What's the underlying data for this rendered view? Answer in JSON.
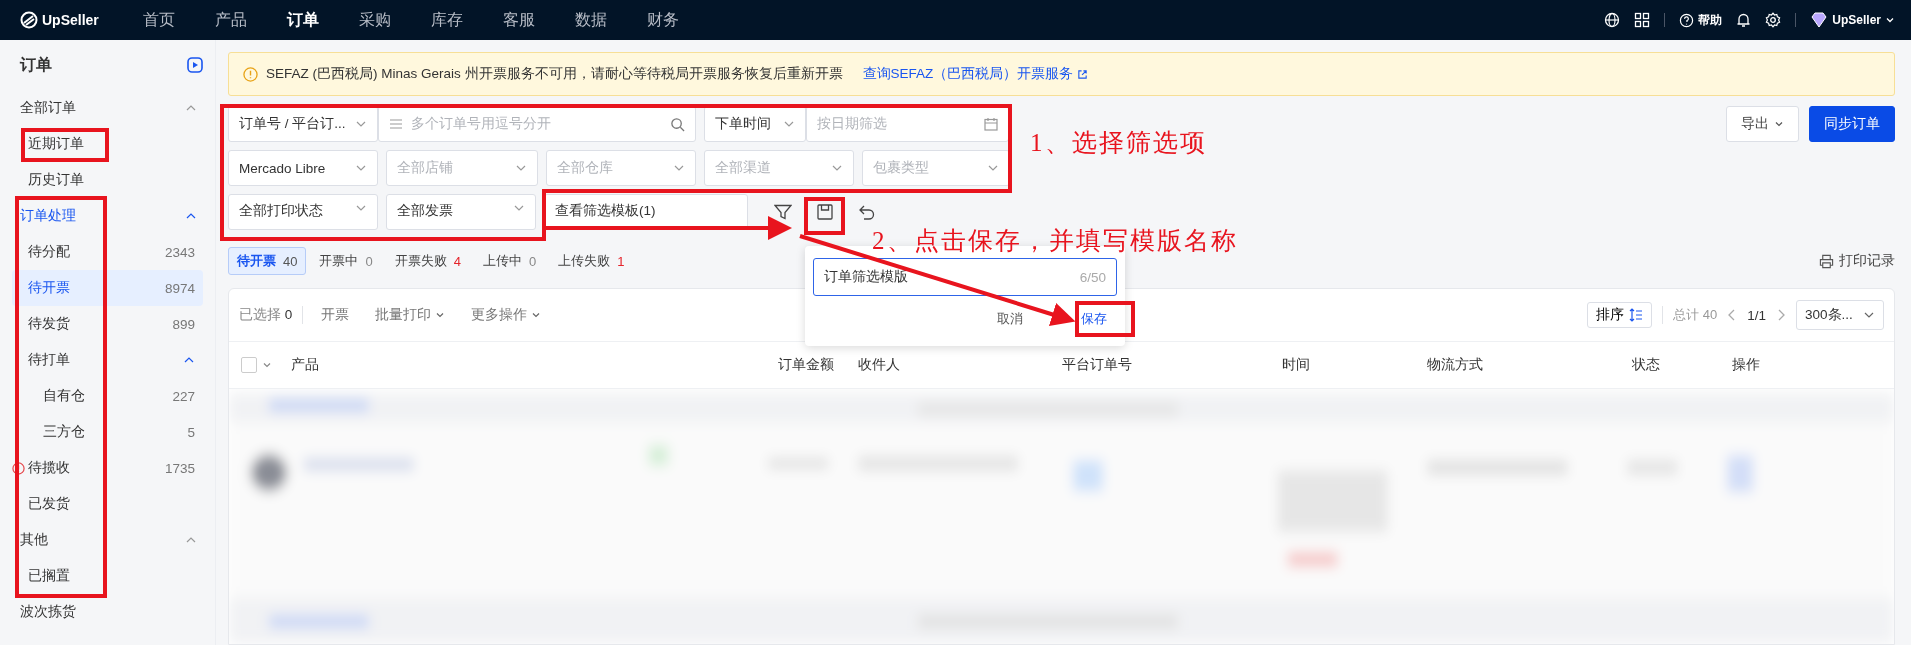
{
  "topbar": {
    "logo": "UpSeller",
    "nav": [
      {
        "label": "首页",
        "selected": false
      },
      {
        "label": "产品",
        "selected": false
      },
      {
        "label": "订单",
        "selected": true
      },
      {
        "label": "采购",
        "selected": false
      },
      {
        "label": "库存",
        "selected": false
      },
      {
        "label": "客服",
        "selected": false
      },
      {
        "label": "数据",
        "selected": false
      },
      {
        "label": "财务",
        "selected": false
      }
    ],
    "help": "帮助",
    "account": "UpSeller"
  },
  "sidebar": {
    "title": "订单",
    "groups": [
      {
        "kind": "group",
        "label": "全部订单",
        "selected": false,
        "expanded": true,
        "items": [
          {
            "label": "近期订单",
            "selected": false
          },
          {
            "label": "历史订单",
            "selected": false
          }
        ]
      },
      {
        "kind": "group",
        "label": "订单处理",
        "selected": true,
        "expanded": true,
        "items": [
          {
            "label": "待分配",
            "count": "2343",
            "selected": false,
            "alert": false
          },
          {
            "label": "待开票",
            "count": "8974",
            "selected": true,
            "alert": false
          },
          {
            "label": "待发货",
            "count": "899",
            "selected": false,
            "alert": false
          },
          {
            "label": "待打单",
            "selected": false,
            "expanded": true,
            "children": [
              {
                "label": "自有仓",
                "count": "227",
                "selected": false
              },
              {
                "label": "三方仓",
                "count": "5",
                "selected": false
              }
            ]
          },
          {
            "label": "待揽收",
            "count": "1735",
            "selected": false,
            "alert": true
          },
          {
            "label": "已发货",
            "selected": false,
            "alert": false
          }
        ]
      },
      {
        "kind": "group",
        "label": "其他",
        "selected": false,
        "expanded": true,
        "items": [
          {
            "label": "已搁置",
            "selected": false
          }
        ]
      },
      {
        "kind": "link",
        "label": "波次拣货",
        "selected": false
      }
    ]
  },
  "banner": {
    "text": "SEFAZ (巴西税局) Minas Gerais 州开票服务不可用，请耐心等待税局开票服务恢复后重新开票",
    "link": "查询SEFAZ（巴西税局）开票服务"
  },
  "filters": [
    [
      {
        "kind": "select",
        "value": "订单号 / 平台订..."
      },
      {
        "kind": "search",
        "placeholder": "多个订单号用逗号分开"
      },
      {
        "kind": "select",
        "value": "下单时间"
      },
      {
        "kind": "date",
        "placeholder": "按日期筛选"
      }
    ],
    [
      {
        "kind": "select",
        "value": "Mercado Libre"
      },
      {
        "kind": "select",
        "placeholder": "全部店铺"
      },
      {
        "kind": "select",
        "placeholder": "全部仓库"
      },
      {
        "kind": "select",
        "placeholder": "全部渠道"
      },
      {
        "kind": "select",
        "placeholder": "包裹类型"
      }
    ],
    [
      {
        "kind": "select",
        "value": "全部打印状态"
      },
      {
        "kind": "select",
        "value": "全部发票"
      },
      {
        "kind": "template",
        "value": "查看筛选模板(1)"
      }
    ]
  ],
  "actions": {
    "export": "导出",
    "sync": "同步订单"
  },
  "status_tabs": [
    {
      "label": "待开票",
      "count": "40",
      "selected": true,
      "alert": false
    },
    {
      "label": "开票中",
      "count": "0",
      "selected": false,
      "alert": false
    },
    {
      "label": "开票失败",
      "count": "4",
      "selected": false,
      "alert": true
    },
    {
      "label": "上传中",
      "count": "0",
      "selected": false,
      "alert": false
    },
    {
      "label": "上传失败",
      "count": "1",
      "selected": false,
      "alert": true
    }
  ],
  "print_log": "打印记录",
  "toolbar": {
    "selected_label": "已选择",
    "selected_count": "0",
    "buttons": [
      {
        "label": "开票",
        "dropdown": false
      },
      {
        "label": "批量打印",
        "dropdown": true
      },
      {
        "label": "更多操作",
        "dropdown": true
      }
    ],
    "sort": "排序",
    "total": "总计 40",
    "page": "1/1",
    "page_size": "300条..."
  },
  "table": {
    "all_checked": false,
    "columns": [
      "产品",
      "订单金额",
      "收件人",
      "平台订单号",
      "时间",
      "物流方式",
      "状态",
      "操作"
    ]
  },
  "popup": {
    "value": "订单筛选模版",
    "counter": "6/50",
    "cancel": "取消",
    "save": "保存"
  },
  "annotations": [
    {
      "text": "1、选择筛选项"
    },
    {
      "text": "2、点击保存，并填写模版名称"
    }
  ]
}
